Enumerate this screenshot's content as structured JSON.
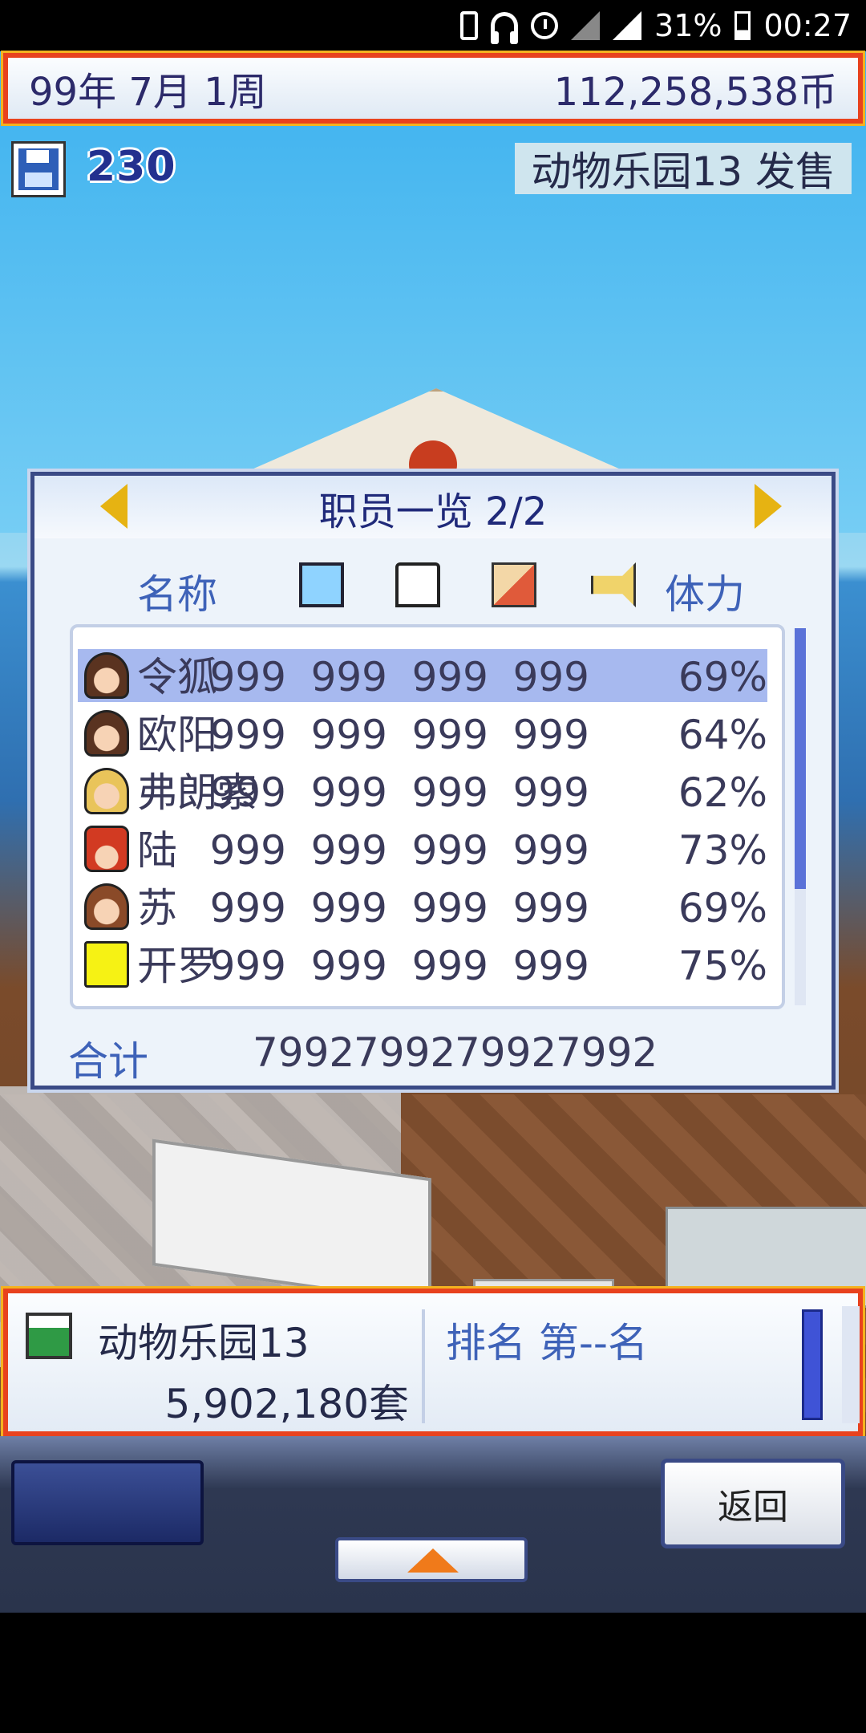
{
  "status_bar": {
    "battery": "31%",
    "time": "00:27"
  },
  "header": {
    "date": "99年 7月 1周",
    "money": "112,258,538币"
  },
  "save": {
    "count": "230"
  },
  "event": {
    "text": "动物乐园13 发售"
  },
  "staff_panel": {
    "title": "职员一览 2/2",
    "col_name": "名称",
    "col_stamina": "体力",
    "rows": [
      {
        "name": "令狐",
        "s1": "999",
        "s2": "999",
        "s3": "999",
        "s4": "999",
        "stamina": "69%"
      },
      {
        "name": "欧阳",
        "s1": "999",
        "s2": "999",
        "s3": "999",
        "s4": "999",
        "stamina": "64%"
      },
      {
        "name": "弗朗索",
        "s1": "999",
        "s2": "999",
        "s3": "999",
        "s4": "999",
        "stamina": "62%"
      },
      {
        "name": "陆",
        "s1": "999",
        "s2": "999",
        "s3": "999",
        "s4": "999",
        "stamina": "73%"
      },
      {
        "name": "苏",
        "s1": "999",
        "s2": "999",
        "s3": "999",
        "s4": "999",
        "stamina": "69%"
      },
      {
        "name": "开罗",
        "s1": "999",
        "s2": "999",
        "s3": "999",
        "s4": "999",
        "stamina": "75%"
      }
    ],
    "total_label": "合计",
    "totals": {
      "t1": "7992",
      "t2": "7992",
      "t3": "7992",
      "t4": "7992"
    }
  },
  "product": {
    "name": "动物乐园13",
    "sales": "5,902,180套",
    "rank": "排名 第--名"
  },
  "buttons": {
    "back": "返回"
  }
}
